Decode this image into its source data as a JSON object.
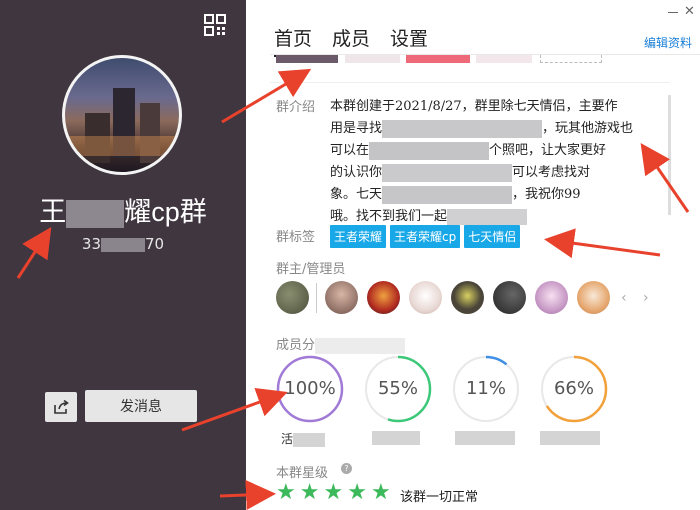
{
  "left": {
    "group_name": "王者荣耀cp群",
    "group_name_visible_start": "王",
    "group_name_visible_end": "耀cp群",
    "group_id_start": "33",
    "group_id_end": "70",
    "message_button": "发消息",
    "icons": {
      "qr": "qr-code-icon",
      "share": "share-icon"
    }
  },
  "tabs": [
    {
      "label": "首页",
      "active": true
    },
    {
      "label": "成员",
      "active": false
    },
    {
      "label": "设置",
      "active": false
    }
  ],
  "edit_link": "编辑资料",
  "intro": {
    "label": "群介绍",
    "line1": "本群创建于2021/8/27，群里除七天情侣，主要作",
    "line2": "用是寻找",
    "line2b": "，玩其他游戏也",
    "line3": "可以在",
    "line3b": "个照吧，让大家更好",
    "line4": "的认识你",
    "line4b": "可以考虑找对",
    "line5": "象。七天",
    "line5b": "，我祝你99",
    "line6": "哦。找不到我们一起"
  },
  "tags": {
    "label": "群标签",
    "items": [
      "王者荣耀",
      "王者荣耀cp",
      "七天情侣"
    ]
  },
  "admins": {
    "label": "群主/管理员",
    "avatars": [
      "#6b6f5a",
      "#b49080",
      "#c04030",
      "#e0d0cc",
      "#5a5040",
      "#3a3a3a",
      "#d8c0d8",
      "#e0b090"
    ]
  },
  "members": {
    "label_visible": "成员分",
    "rings": [
      {
        "value": 100,
        "text": "100%",
        "color": "#a07ad6",
        "label": "活"
      },
      {
        "value": 55,
        "text": "55%",
        "color": "#3cc878",
        "label": ""
      },
      {
        "value": 11,
        "text": "11%",
        "color": "#3f8fe6",
        "label": ""
      },
      {
        "value": 66,
        "text": "66%",
        "color": "#f2a13a",
        "label": ""
      }
    ]
  },
  "level": {
    "label": "本群星级",
    "help": "?",
    "stars": 5,
    "status": "该群一切正常"
  },
  "colors": {
    "panel": "#3f3640",
    "accent": "#18a8e8",
    "star": "#3cb95a",
    "arrow": "#e8412c"
  }
}
